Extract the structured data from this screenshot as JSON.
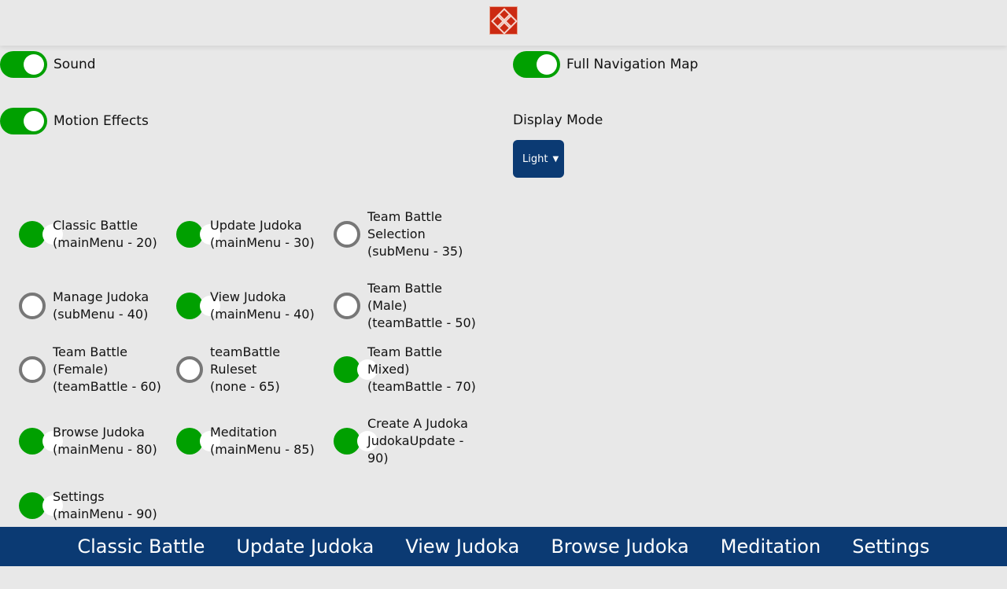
{
  "header": {
    "logo_icon": "judo-knot-icon",
    "logo_color": "#cc2a12"
  },
  "settings": {
    "sound": {
      "label": "Sound",
      "enabled": true
    },
    "motion": {
      "label": "Motion Effects",
      "enabled": true
    },
    "nav_map": {
      "label": "Full Navigation Map",
      "enabled": true
    },
    "display_mode": {
      "label": "Display Mode",
      "selected": "Light"
    }
  },
  "menu_items": [
    {
      "name": "Classic Battle",
      "meta": "(mainMenu - 20)",
      "enabled": true
    },
    {
      "name": "Update Judoka",
      "meta": "(mainMenu - 30)",
      "enabled": true
    },
    {
      "name": "Team Battle Selection",
      "meta": "(subMenu - 35)",
      "enabled": false
    },
    {
      "name": "Manage Judoka",
      "meta": "(subMenu - 40)",
      "enabled": false
    },
    {
      "name": "View Judoka",
      "meta": "(mainMenu - 40)",
      "enabled": true
    },
    {
      "name": "Team Battle (Male)",
      "meta": "(teamBattle - 50)",
      "enabled": false
    },
    {
      "name": "Team Battle (Female)",
      "meta": "(teamBattle - 60)",
      "enabled": false
    },
    {
      "name": "teamBattle Ruleset",
      "meta": "(none - 65)",
      "enabled": false
    },
    {
      "name": "Team Battle Mixed)",
      "meta": "(teamBattle - 70)",
      "enabled": true
    },
    {
      "name": "Browse Judoka",
      "meta": "(mainMenu - 80)",
      "enabled": true
    },
    {
      "name": "Meditation",
      "meta": "(mainMenu - 85)",
      "enabled": true
    },
    {
      "name": "Create A Judoka",
      "meta": "JudokaUpdate - 90)",
      "enabled": true
    },
    {
      "name": "Settings",
      "meta": "(mainMenu - 90)",
      "enabled": true
    }
  ],
  "footer": {
    "links": [
      "Classic Battle",
      "Update Judoka",
      "View Judoka",
      "Browse Judoka",
      "Meditation",
      "Settings"
    ]
  },
  "colors": {
    "accent_green": "#00a000",
    "nav_blue": "#0b3a73",
    "background": "#e8e8e8"
  }
}
